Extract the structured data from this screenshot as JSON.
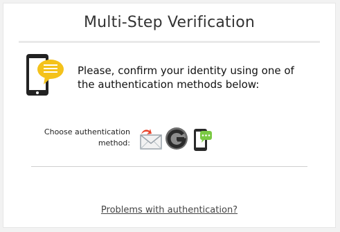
{
  "dialog": {
    "title": "Multi-Step Verification",
    "message_line1": "Please, confirm your identity using one of",
    "message_line2": "the authentication methods below:",
    "choose_line1": "Choose authentication",
    "choose_line2": "method:",
    "methods": [
      {
        "name": "email",
        "icon": "email-icon"
      },
      {
        "name": "google",
        "icon": "google-authenticator-icon"
      },
      {
        "name": "sms",
        "icon": "sms-phone-icon"
      }
    ],
    "problems_link": "Problems with authentication?"
  },
  "colors": {
    "bubble": "#f4c21b",
    "phone": "#222222",
    "sms_bubble": "#7ac943",
    "email_arrow": "#e8452c"
  }
}
